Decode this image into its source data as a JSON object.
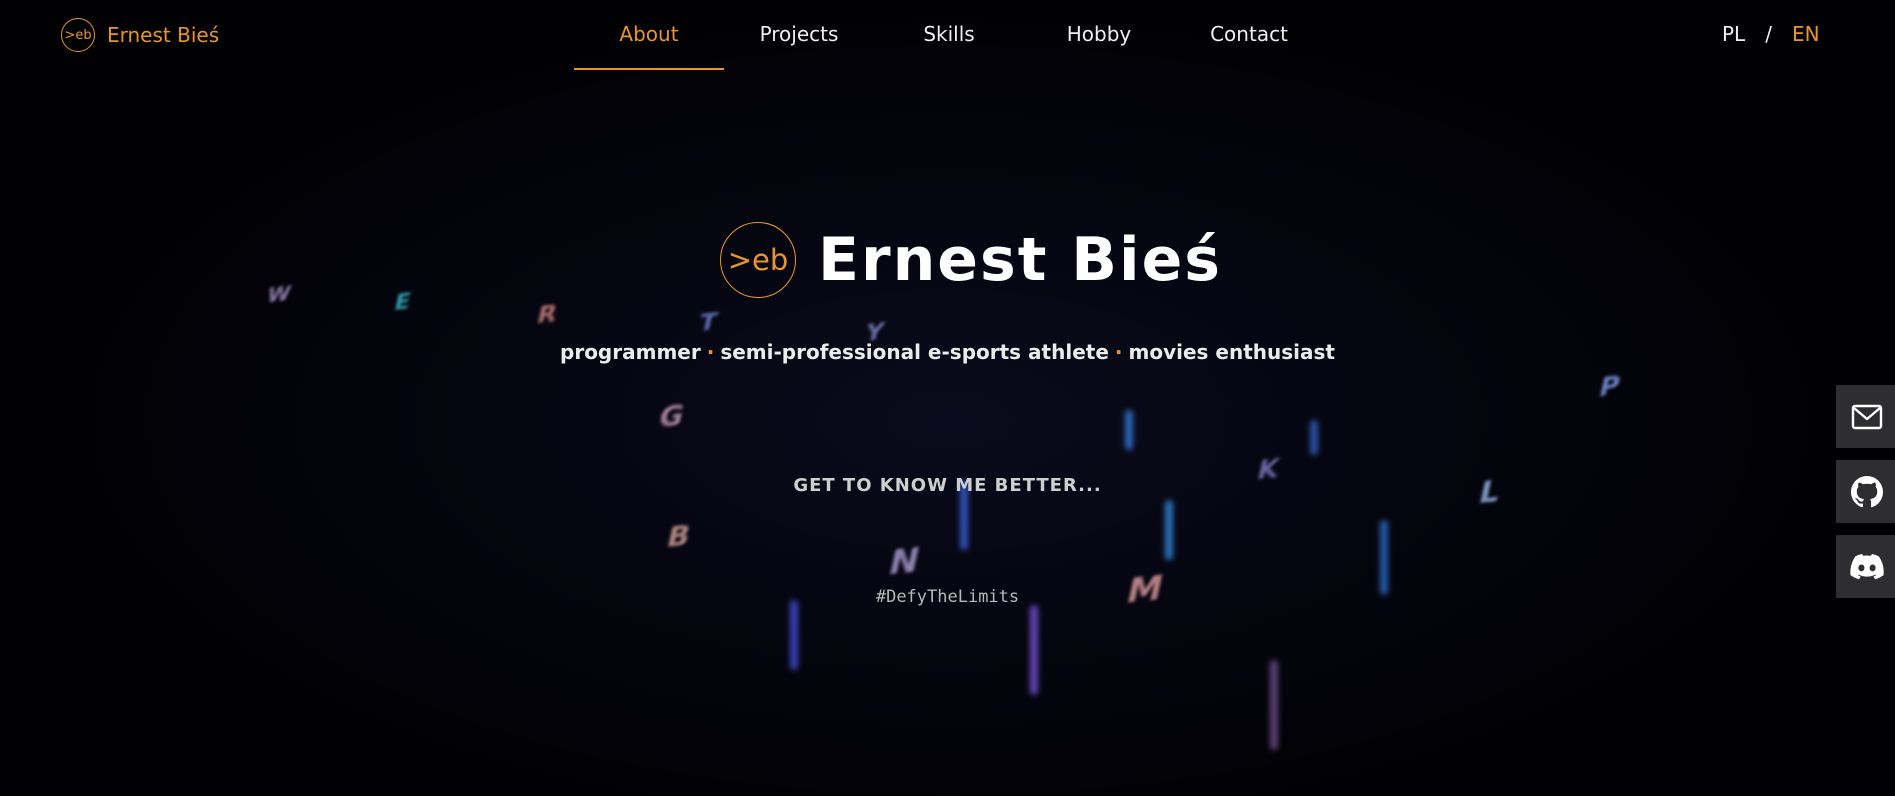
{
  "header": {
    "brand_logo": ">eb",
    "brand_name": "Ernest Bieś",
    "nav": [
      {
        "label": "About",
        "active": true
      },
      {
        "label": "Projects",
        "active": false
      },
      {
        "label": "Skills",
        "active": false
      },
      {
        "label": "Hobby",
        "active": false
      },
      {
        "label": "Contact",
        "active": false
      }
    ],
    "lang": {
      "pl": "PL",
      "sep": "/",
      "en": "EN",
      "active": "EN"
    }
  },
  "hero": {
    "logo": ">eb",
    "name": "Ernest Bieś",
    "tagline": [
      "programmer",
      "semi-professional e-sports athlete",
      "movies enthusiast"
    ],
    "tagline_sep": "·",
    "cta": "GET TO KNOW ME BETTER...",
    "hashtag": "#DefyTheLimits"
  },
  "social": [
    {
      "name": "email",
      "icon": "envelope-icon"
    },
    {
      "name": "github",
      "icon": "github-icon"
    },
    {
      "name": "discord",
      "icon": "discord-icon"
    }
  ],
  "colors": {
    "accent": "#e8962c",
    "text": "#f0f0f0",
    "background": "#020208",
    "social_bg": "#2e2e30"
  },
  "background_keys": [
    "W",
    "E",
    "R",
    "T",
    "Y",
    "G",
    "B",
    "N",
    "M",
    "K",
    "L",
    "P"
  ]
}
